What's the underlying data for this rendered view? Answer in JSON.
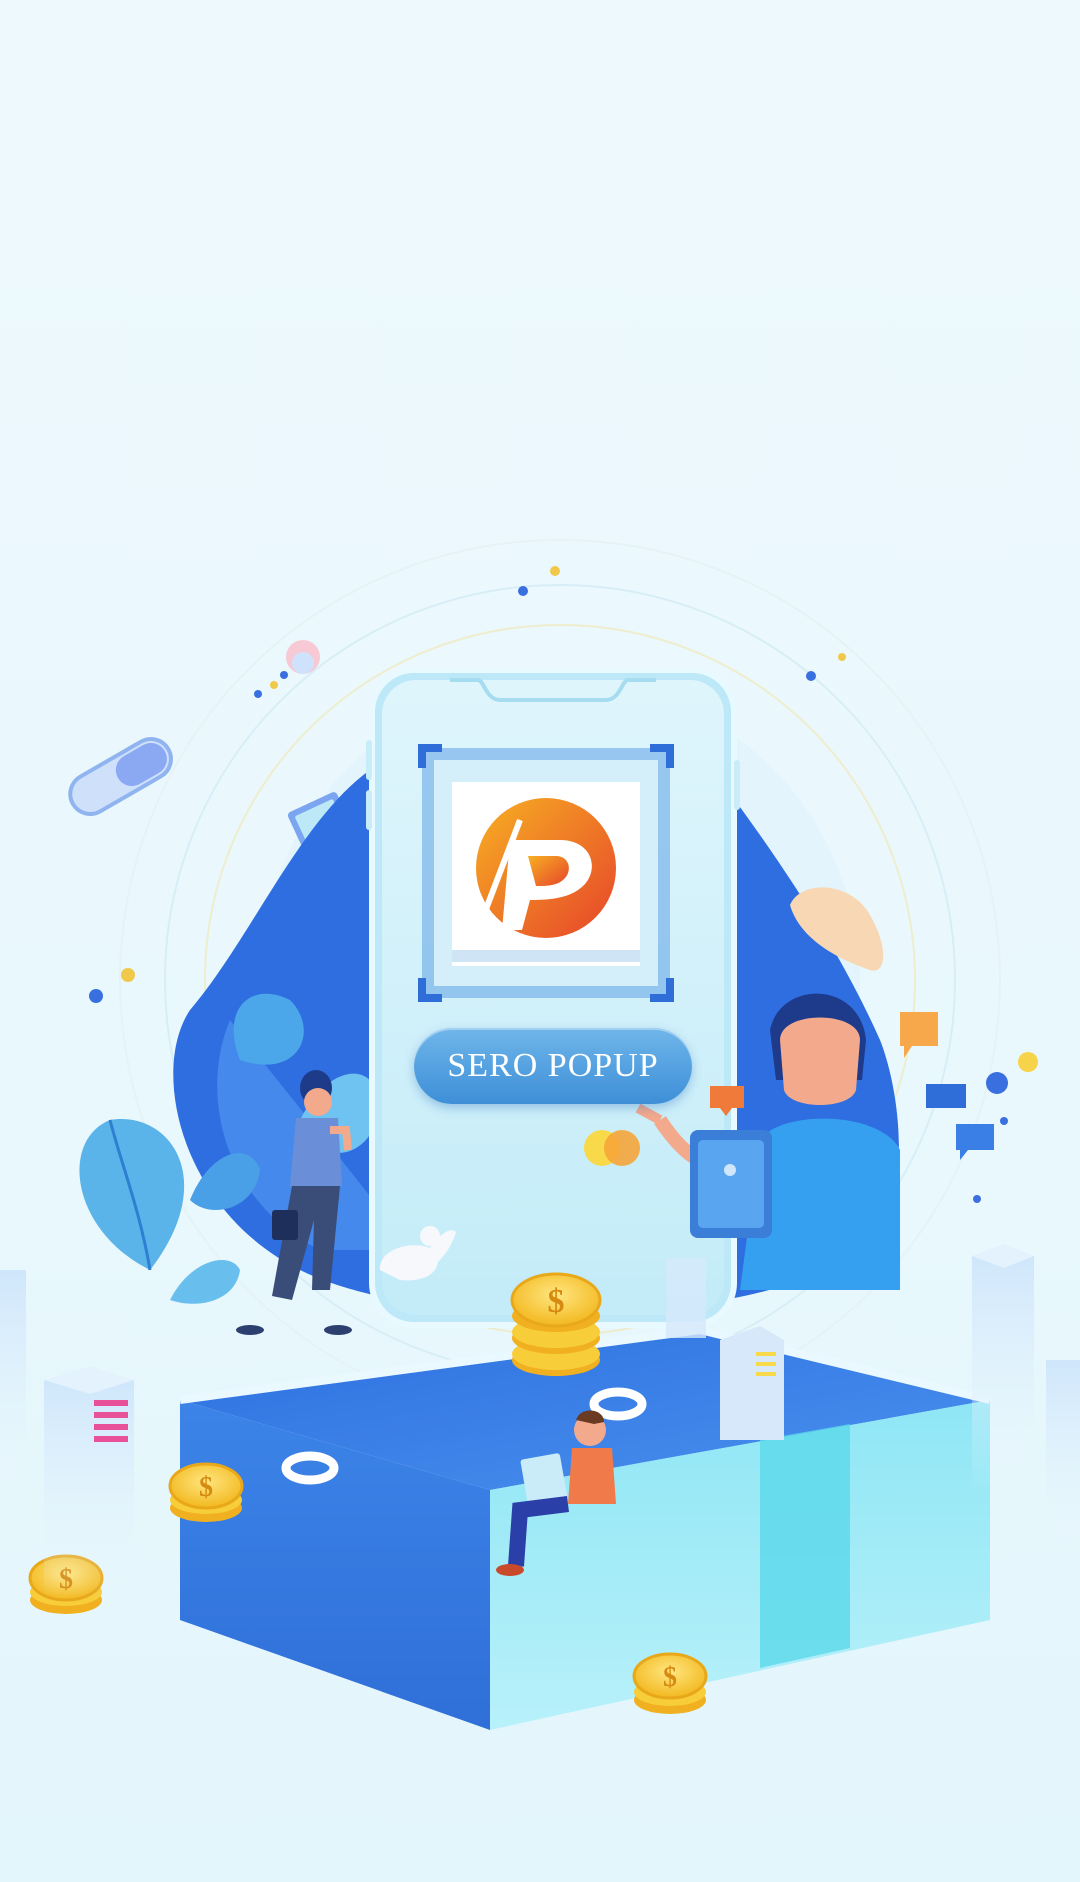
{
  "splash": {
    "app_name": "SERO POPUP",
    "logo_icon": "sero-popup-p-logo-icon"
  },
  "colors": {
    "background": "#eaf8fd",
    "primary_blue": "#3a7de0",
    "light_blue": "#9ee3f3",
    "logo_orange": "#f39a1e",
    "logo_red": "#e8472b",
    "coin_gold": "#f6c82b"
  }
}
